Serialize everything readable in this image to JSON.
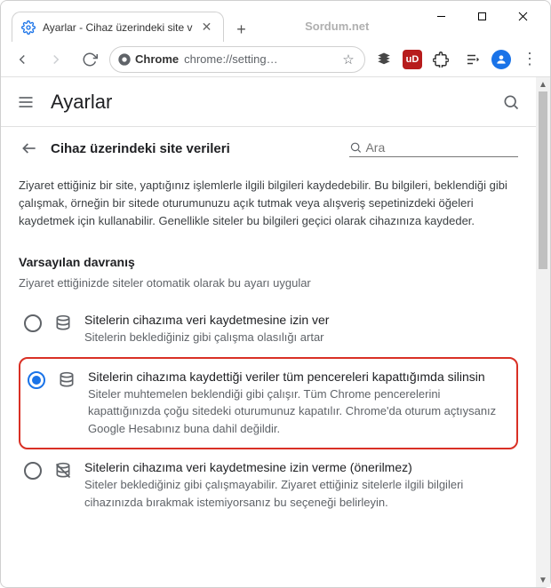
{
  "window": {
    "watermark": "Sordum.net",
    "tab_title": "Ayarlar - Cihaz üzerindeki site v"
  },
  "toolbar": {
    "chrome_label": "Chrome",
    "url": "chrome://setting…",
    "ublock_badge": "uD"
  },
  "app": {
    "title": "Ayarlar"
  },
  "sub": {
    "title": "Cihaz üzerindeki site verileri",
    "search_placeholder": "Ara"
  },
  "description": "Ziyaret ettiğiniz bir site, yaptığınız işlemlerle ilgili bilgileri kaydedebilir. Bu bilgileri, beklendiği gibi çalışmak, örneğin bir sitede oturumunuzu açık tutmak veya alışveriş sepetinizdeki öğeleri kaydetmek için kullanabilir. Genellikle siteler bu bilgileri geçici olarak cihazınıza kaydeder.",
  "section": {
    "title": "Varsayılan davranış",
    "subtitle": "Ziyaret ettiğinizde siteler otomatik olarak bu ayarı uygular"
  },
  "options": [
    {
      "title": "Sitelerin cihazıma veri kaydetmesine izin ver",
      "desc": "Sitelerin beklediğiniz gibi çalışma olasılığı artar",
      "checked": false
    },
    {
      "title": "Sitelerin cihazıma kaydettiği veriler tüm pencereleri kapattığımda silinsin",
      "desc": "Siteler muhtemelen beklendiği gibi çalışır. Tüm Chrome pencerelerini kapattığınızda çoğu sitedeki oturumunuz kapatılır. Chrome'da oturum açtıysanız Google Hesabınız buna dahil değildir.",
      "checked": true
    },
    {
      "title": "Sitelerin cihazıma veri kaydetmesine izin verme (önerilmez)",
      "desc": "Siteler beklediğiniz gibi çalışmayabilir. Ziyaret ettiğiniz sitelerle ilgili bilgileri cihazınızda bırakmak istemiyorsanız bu seçeneği belirleyin.",
      "checked": false
    }
  ]
}
